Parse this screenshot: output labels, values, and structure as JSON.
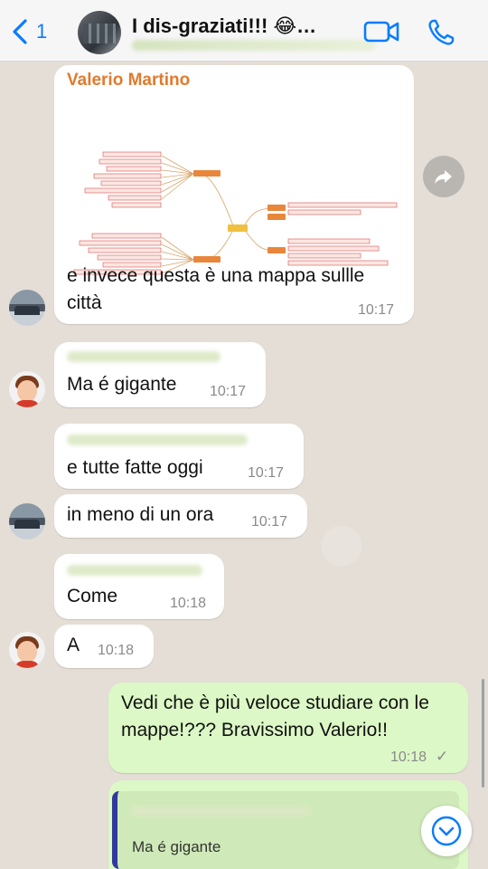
{
  "header": {
    "back_count": "1",
    "title": "I dis-graziati!!! 😂…"
  },
  "messages": [
    {
      "id": "m1",
      "sender": "Valerio Martino",
      "text": "e invece questa è una mappa sullle città",
      "time": "10:17"
    },
    {
      "id": "m2",
      "text": "Ma é gigante",
      "time": "10:17"
    },
    {
      "id": "m3",
      "text": "e tutte fatte oggi",
      "time": "10:17"
    },
    {
      "id": "m4",
      "text": "in meno di un ora",
      "time": "10:17"
    },
    {
      "id": "m5",
      "text": "Come",
      "time": "10:18"
    },
    {
      "id": "m6",
      "text": "A",
      "time": "10:18"
    },
    {
      "id": "m7",
      "text": "Vedi che è più veloce studiare con le mappe!??? Bravissimo Valerio!!",
      "time": "10:18",
      "status": "✓"
    }
  ],
  "reply": {
    "quoted_text": "Ma é gigante"
  },
  "colors": {
    "accent": "#0a7cff",
    "sender_name": "#e07b2e",
    "outgoing_bubble": "#dcf8c6",
    "incoming_bubble": "#ffffff",
    "quote_bar": "#2f3a9c"
  },
  "icons": [
    "chevron-left-icon",
    "video-camera-icon",
    "phone-icon",
    "forward-icon",
    "chevron-down-circle-icon"
  ]
}
